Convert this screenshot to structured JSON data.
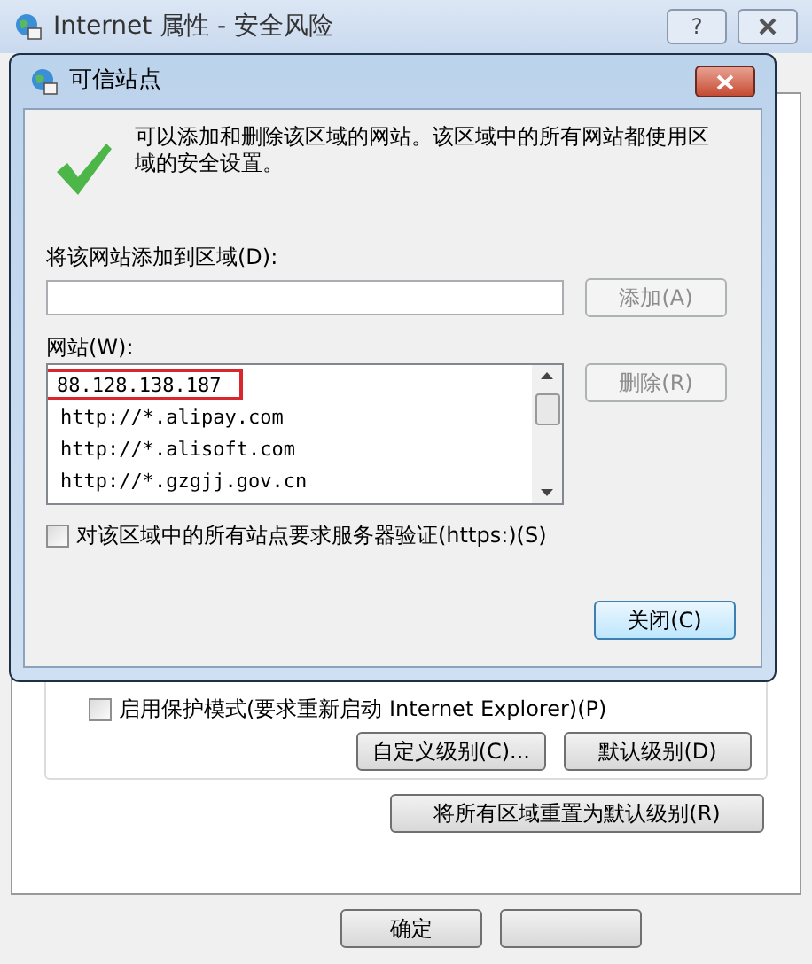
{
  "window": {
    "title": "Internet 属性 - 安全风险",
    "help_button": "?"
  },
  "dialog": {
    "title": "可信站点",
    "message": "可以添加和删除该区域的网站。该区域中的所有网站都使用区域的安全设置。",
    "add_label": "将该网站添加到区域(D):",
    "add_button": {
      "label": "添加(A)",
      "disabled": true
    },
    "sites_label": "网站(W):",
    "sites": [
      {
        "text": "88.128.138.187",
        "highlighted": true
      },
      {
        "text": "http://*.alipay.com",
        "highlighted": false
      },
      {
        "text": "http://*.alisoft.com",
        "highlighted": false
      },
      {
        "text": "http://*.gzgjj.gov.cn",
        "highlighted": false
      }
    ],
    "remove_button": {
      "label": "删除(R)",
      "disabled": true
    },
    "https_checkbox": {
      "label": "对该区域中的所有站点要求服务器验证(https:)(S)",
      "checked": false
    },
    "close_button": "关闭(C)"
  },
  "protected_mode": {
    "label": "启用保护模式(要求重新启动 Internet Explorer)(P)",
    "checked": false
  },
  "level_buttons": [
    "自定义级别(C)...",
    "默认级别(D)"
  ],
  "reset_button": "将所有区域重置为默认级别(R)",
  "footer_buttons": [
    "确定"
  ]
}
